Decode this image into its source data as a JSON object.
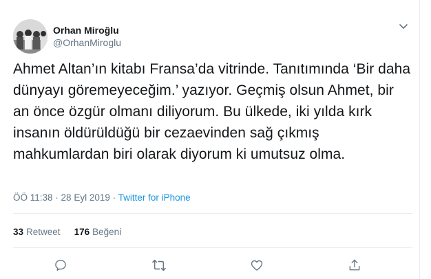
{
  "user": {
    "display_name": "Orhan Miroğlu",
    "handle": "@OrhanMiroglu"
  },
  "tweet": {
    "text": "Ahmet Altan’ın kitabı Fransa’da vitrinde. Tanıtımında ‘Bir daha dünyayı göremeyeceğim.’ yazıyor. Geçmiş olsun Ahmet, bir an önce özgür olmanı diliyorum. Bu ülkede, iki yılda kırk insanın öldürüldüğü bir cezaevinden sağ çıkmış mahkumlardan biri olarak diyorum ki umutsuz olma.",
    "time": "ÖÖ 11:38",
    "separator1": " · ",
    "date": "28 Eyl 2019",
    "separator2": " · ",
    "source": "Twitter for iPhone"
  },
  "stats": {
    "retweet_count": "33",
    "retweet_label": "Retweet",
    "like_count": "176",
    "like_label": "Beğeni"
  },
  "icons": {
    "menu": "chevron-down-icon",
    "reply": "reply-icon",
    "retweet": "retweet-icon",
    "like": "heart-icon",
    "share": "share-icon"
  },
  "colors": {
    "text": "#14171a",
    "secondary": "#657786",
    "link": "#1b95e0",
    "divider": "#e6ecf0"
  }
}
